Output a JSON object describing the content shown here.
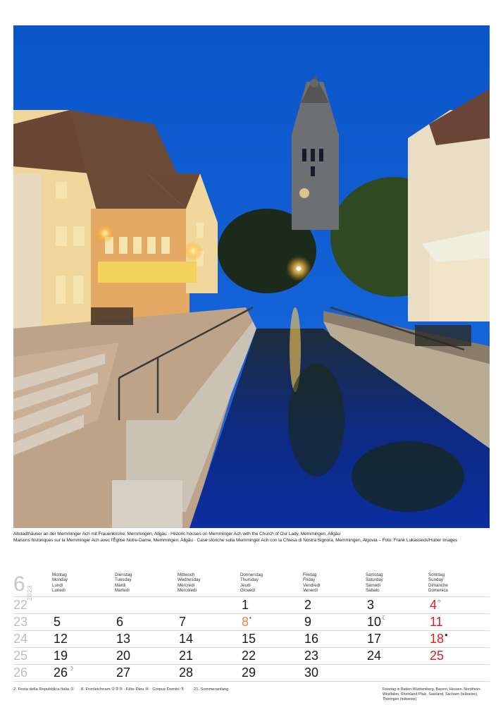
{
  "caption": {
    "line1": "Altstadthäuser an der Memminger Ach mit Frauenkirche, Memmingen, Allgäu · Historic houses on Memminger Ach with the Church of Our Lady, Memmingen, Allgäu",
    "line2": "Maisons historiques sur la Memminger Ach avec l'Église Notre-Dame, Memmingen, Allgäu · Case storiche sulla Memminger Ach con la Chiesa di Nostra Signora, Memmingen, Algovia – Foto: Frank Lukasseck/Huber Images"
  },
  "calendar": {
    "month": "6",
    "year": "2023",
    "weekdays": [
      {
        "de": "Montag",
        "en": "Monday",
        "fr": "Lundi",
        "it": "Lunedì"
      },
      {
        "de": "Dienstag",
        "en": "Tuesday",
        "fr": "Mardi",
        "it": "Martedì"
      },
      {
        "de": "Mittwoch",
        "en": "Wednesday",
        "fr": "Mercredi",
        "it": "Mercoledì"
      },
      {
        "de": "Donnerstag",
        "en": "Thursday",
        "fr": "Jeudi",
        "it": "Giovedì"
      },
      {
        "de": "Freitag",
        "en": "Friday",
        "fr": "Vendredi",
        "it": "Venerdì"
      },
      {
        "de": "Samstag",
        "en": "Saturday",
        "fr": "Samedi",
        "it": "Sabato"
      },
      {
        "de": "Sonntag",
        "en": "Sunday",
        "fr": "Dimanche",
        "it": "Domenica"
      }
    ],
    "weeks": [
      {
        "num": "22",
        "days": [
          "",
          "",
          "",
          "1",
          "2",
          "3",
          "4"
        ]
      },
      {
        "num": "23",
        "days": [
          "5",
          "6",
          "7",
          "8",
          "9",
          "10",
          "11"
        ]
      },
      {
        "num": "24",
        "days": [
          "12",
          "13",
          "14",
          "15",
          "16",
          "17",
          "18"
        ]
      },
      {
        "num": "25",
        "days": [
          "19",
          "20",
          "21",
          "22",
          "23",
          "24",
          "25"
        ]
      },
      {
        "num": "26",
        "days": [
          "26",
          "27",
          "28",
          "29",
          "30",
          "",
          ""
        ]
      }
    ],
    "moons": {
      "4": "○",
      "8": "•",
      "10": "☾",
      "18": "●",
      "26": "☽"
    },
    "colors": {
      "sunday": "#d62020",
      "holiday": "#e58a46",
      "month": "#c7c7c7"
    }
  },
  "footer": {
    "note1": "2. Festa della Repubblica Italia ①",
    "note2": "8. Fronleichnam ①②③ · Fête-Dieu ④ · Corpus Domini ⑤",
    "note3": "21. Sommeranfang",
    "note4": "Feiertag in Baden-Württemberg, Bayern, Hessen, Nordrhein-Westfalen, Rheinland-Pfalz, Saarland, Sachsen (teilweise), Thüringen (teilweise)"
  }
}
